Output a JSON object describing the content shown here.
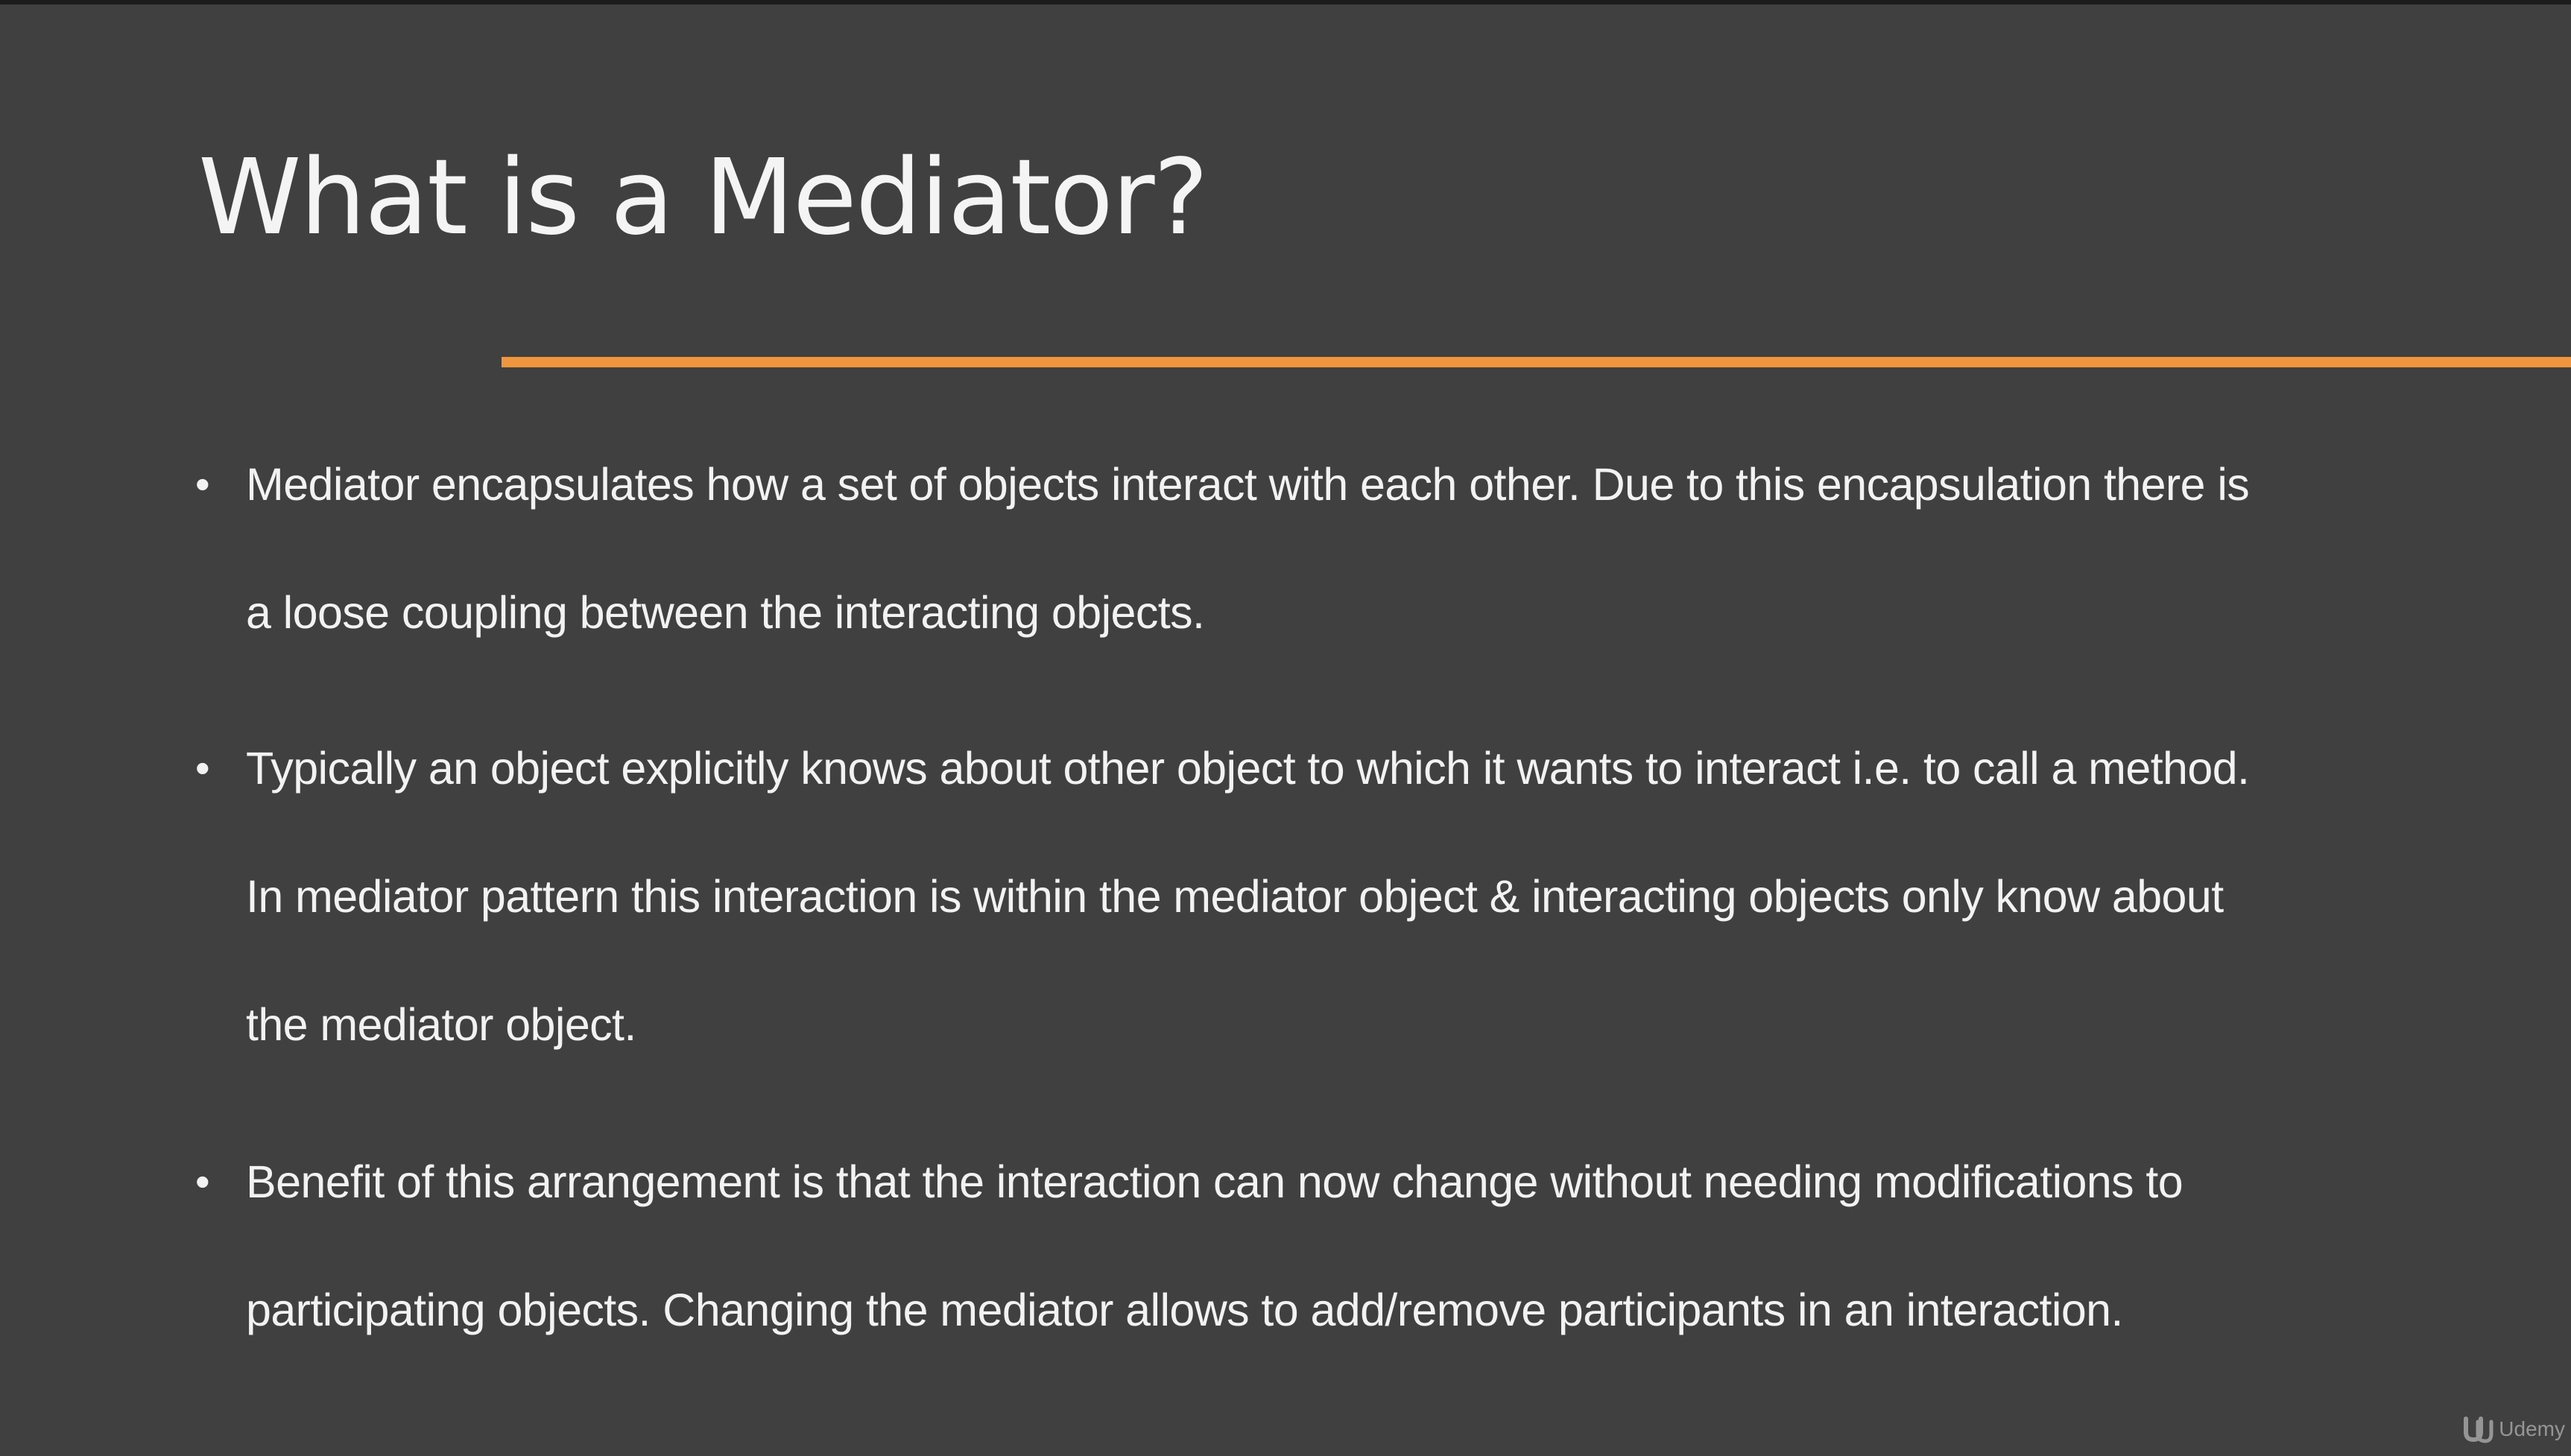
{
  "slide": {
    "title": "What is a Mediator?",
    "accent_color": "#f0963c",
    "background_color": "#404040",
    "bullets": [
      {
        "text": "Mediator encapsulates how a set of objects interact with each other. Due to this encapsulation there is\na loose coupling between the interacting objects."
      },
      {
        "text": "Typically an object explicitly knows about other object to which it wants to interact i.e. to call a method.\nIn mediator pattern this interaction is within the mediator object & interacting objects only know about\nthe mediator object."
      },
      {
        "text": "Benefit of this arrangement is that the interaction can now change without needing modifications to\nparticipating objects. Changing the mediator allows to add/remove participants in an interaction."
      }
    ]
  },
  "watermark": {
    "icon": "udemy-logo-icon",
    "label": "Udemy"
  }
}
